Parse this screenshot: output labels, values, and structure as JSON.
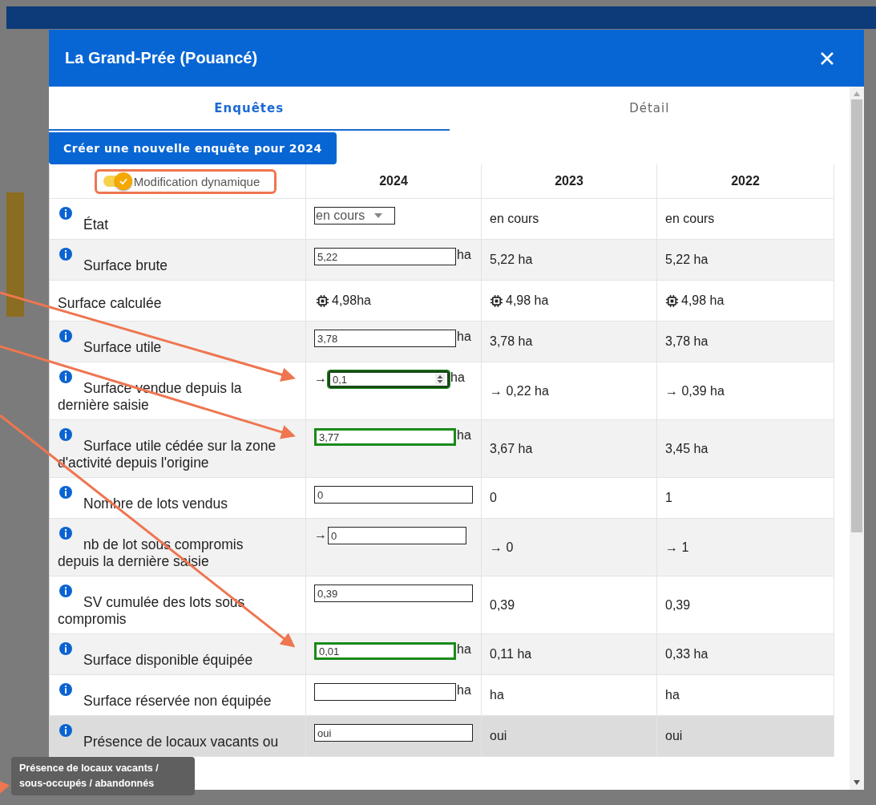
{
  "window": {
    "title": "La Grand-Prée (Pouancé)"
  },
  "tabs": [
    {
      "label": "Enquêtes",
      "selected": true
    },
    {
      "label": "Détail",
      "selected": false
    }
  ],
  "create_button": "Créer une nouvelle enquête pour 2024",
  "toggle": {
    "label": "Modification dynamique",
    "on": true
  },
  "table": {
    "columns": [
      "2024",
      "2023",
      "2022"
    ],
    "rows": [
      {
        "label": "État",
        "info": true,
        "kind": "select",
        "value": "en cours",
        "hovered": false,
        "cells": [
          "en cours",
          "en cours"
        ]
      },
      {
        "label": "Surface brute",
        "info": true,
        "kind": "input",
        "value": "5,22",
        "unit": "ha",
        "focused": false,
        "valid": false,
        "hovered": false,
        "cells": [
          "5,22 ha",
          "5,22 ha"
        ]
      },
      {
        "label": "Surface calculée",
        "info": false,
        "kind": "computed",
        "value": "4,98ha",
        "hovered": false,
        "cells": [
          "4,98 ha",
          "4,98 ha"
        ]
      },
      {
        "label": "Surface utile",
        "info": true,
        "kind": "input",
        "value": "3,78",
        "unit": "ha",
        "focused": false,
        "valid": false,
        "hovered": false,
        "cells": [
          "3,78 ha",
          "3,78 ha"
        ]
      },
      {
        "label": "Surface vendue depuis la dernière saisie",
        "info": true,
        "kind": "input",
        "prefix": "→",
        "value": "0,1",
        "unit": "ha",
        "focused": true,
        "valid": true,
        "hovered": false,
        "cells": [
          "→ 0,22 ha",
          "→ 0,39 ha"
        ]
      },
      {
        "label": "Surface utile cédée sur la zone d'activité depuis l'origine",
        "info": true,
        "kind": "input",
        "value": "3,77",
        "unit": "ha",
        "focused": false,
        "valid": true,
        "hovered": false,
        "cells": [
          "3,67 ha",
          "3,45 ha"
        ]
      },
      {
        "label": "Nombre de lots vendus",
        "info": true,
        "kind": "input",
        "value": "0",
        "focused": false,
        "valid": false,
        "hovered": false,
        "cells": [
          "0",
          "1"
        ]
      },
      {
        "label": "nb de lot sous compromis depuis la dernière saisie",
        "info": true,
        "kind": "input",
        "prefix": "→",
        "value": "0",
        "focused": false,
        "valid": false,
        "hovered": false,
        "cells": [
          "→ 0",
          "→ 1"
        ]
      },
      {
        "label": "SV cumulée des lots sous compromis",
        "info": true,
        "kind": "input",
        "value": "0,39",
        "focused": false,
        "valid": false,
        "hovered": false,
        "cells": [
          "0,39",
          "0,39"
        ]
      },
      {
        "label": "Surface disponible équipée",
        "info": true,
        "kind": "input",
        "value": "0,01",
        "unit": "ha",
        "focused": false,
        "valid": true,
        "hovered": false,
        "cells": [
          "0,11 ha",
          "0,33 ha"
        ]
      },
      {
        "label": "Surface réservée non équipée",
        "info": true,
        "kind": "input",
        "unit": "ha",
        "focused": false,
        "valid": false,
        "hovered": false,
        "cells": [
          "ha",
          "ha"
        ]
      },
      {
        "label": "Présence de locaux vacants ou",
        "info": true,
        "kind": "input",
        "value": "oui",
        "focused": false,
        "valid": false,
        "hovered": true,
        "cells": [
          "oui",
          "oui"
        ]
      }
    ]
  },
  "tooltip": "Présence de locaux vacants / sous-occupés / abandonnés"
}
